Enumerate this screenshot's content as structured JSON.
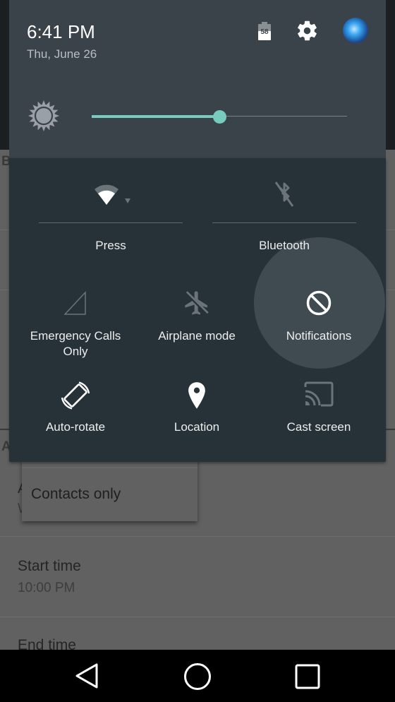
{
  "status_header": {
    "time": "6:41 PM",
    "date": "Thu, June 26",
    "battery_level": "58",
    "icons": [
      "battery-icon",
      "settings-gear-icon",
      "user-avatar"
    ]
  },
  "brightness": {
    "icon": "brightness-sun-icon",
    "value_fraction": 0.5
  },
  "quick_settings": {
    "tiles": [
      {
        "id": "wifi",
        "label": "Press",
        "icon": "wifi-icon",
        "state": "on",
        "has_dropdown": true
      },
      {
        "id": "bluetooth",
        "label": "Bluetooth",
        "icon": "bluetooth-off-icon",
        "state": "off"
      },
      {
        "id": "cellular",
        "label": "Emergency Calls Only",
        "label_lines": [
          "Emergency Calls",
          "Only"
        ],
        "icon": "cell-signal-icon",
        "state": "no-service"
      },
      {
        "id": "airplane",
        "label": "Airplane mode",
        "icon": "airplane-off-icon",
        "state": "off"
      },
      {
        "id": "notifications",
        "label": "Notifications",
        "icon": "do-not-disturb-icon",
        "state": "pressed"
      },
      {
        "id": "rotate",
        "label": "Auto-rotate",
        "icon": "auto-rotate-icon",
        "state": "on"
      },
      {
        "id": "location",
        "label": "Location",
        "icon": "location-pin-icon",
        "state": "on"
      },
      {
        "id": "cast",
        "label": "Cast screen",
        "icon": "cast-icon",
        "state": "off"
      }
    ]
  },
  "background_app": {
    "section_letters": [
      "B",
      "A"
    ],
    "popup_menu": {
      "items": [
        "Contacts only"
      ]
    },
    "rows": [
      {
        "title": "Start time",
        "subtitle": "10:00 PM"
      },
      {
        "title": "End time"
      }
    ],
    "partial_letters": [
      "A",
      "W"
    ]
  },
  "navbar": {
    "buttons": [
      {
        "id": "back",
        "icon": "back-triangle-icon"
      },
      {
        "id": "home",
        "icon": "home-circle-icon"
      },
      {
        "id": "recents",
        "icon": "recents-square-icon"
      }
    ]
  },
  "colors": {
    "accent": "#77cbbf",
    "shade_header": "#3a424a",
    "qs_panel": "#263238"
  }
}
